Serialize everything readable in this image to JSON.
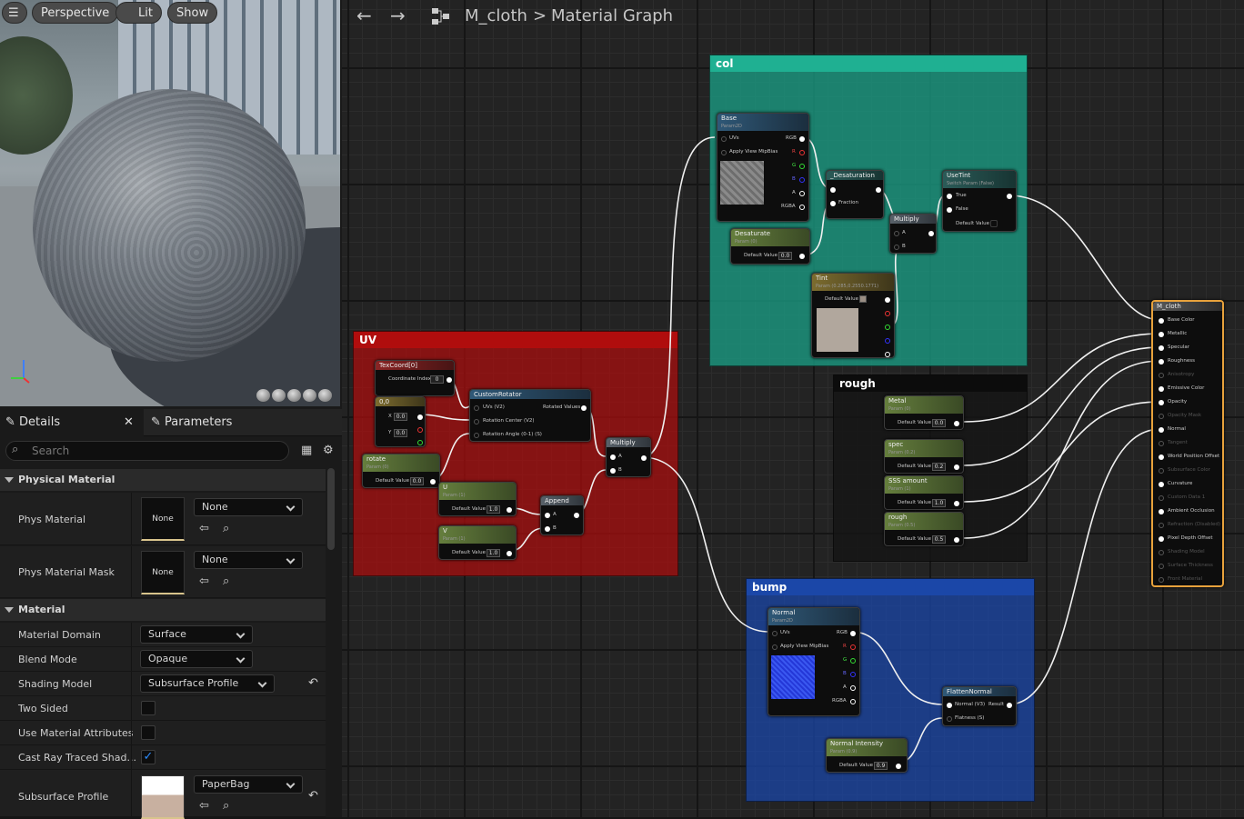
{
  "viewport": {
    "view_mode": "Perspective",
    "lit_mode": "Lit",
    "show_label": "Show"
  },
  "panel": {
    "details_tab": "Details",
    "parameters_tab": "Parameters",
    "search_placeholder": "Search",
    "physical_section": "Physical Material",
    "phys_material": {
      "label": "Phys Material",
      "thumb": "None",
      "value": "None"
    },
    "phys_material_mask": {
      "label": "Phys Material Mask",
      "thumb": "None",
      "value": "None"
    },
    "material_section": "Material",
    "material_domain": {
      "label": "Material Domain",
      "value": "Surface"
    },
    "blend_mode": {
      "label": "Blend Mode",
      "value": "Opaque"
    },
    "shading_model": {
      "label": "Shading Model",
      "value": "Subsurface Profile"
    },
    "two_sided": {
      "label": "Two Sided",
      "checked": false
    },
    "use_material_attributes": {
      "label": "Use Material Attributes",
      "checked": false
    },
    "cast_ray_traced": {
      "label": "Cast Ray Traced Shad...",
      "checked": true
    },
    "subsurface_profile": {
      "label": "Subsurface Profile",
      "value": "PaperBag"
    }
  },
  "graph": {
    "breadcrumb_asset": "M_cloth",
    "breadcrumb_sep": ">",
    "breadcrumb_page": "Material Graph",
    "comments": {
      "col": "col",
      "uv": "UV",
      "rough": "rough",
      "bump": "bump"
    },
    "nodes": {
      "base": {
        "title": "Base",
        "sub": "Param2D",
        "uvs": "UVs",
        "mip": "Apply View MipBias",
        "rgb": "RGB",
        "r": "R",
        "g": "G",
        "b": "B",
        "a": "A",
        "rgba": "RGBA"
      },
      "desat_fn": {
        "title": "_Desaturation",
        "frac": "Fraction"
      },
      "desaturate": {
        "title": "Desaturate",
        "sub": "Param (0)",
        "dv": "Default Value",
        "value": "0.0"
      },
      "multiply_col": {
        "title": "Multiply",
        "a": "A",
        "b": "B"
      },
      "usetint": {
        "title": "UseTint",
        "sub": "Switch Param (False)",
        "t": "True",
        "f": "False",
        "dv": "Default Value"
      },
      "tint": {
        "title": "Tint",
        "sub": "Param (0.285,0.2550.1771)",
        "dv": "Default Value"
      },
      "texcoord": {
        "title": "TexCoord[0]",
        "ci": "Coordinate Index",
        "value": "0"
      },
      "zero": {
        "title": "0,0",
        "x": "X",
        "xv": "0.0",
        "y": "Y",
        "yv": "0.0"
      },
      "rotate": {
        "title": "rotate",
        "sub": "Param (0)",
        "dv": "Default Value",
        "value": "0.0"
      },
      "custom_rotator": {
        "title": "CustomRotator",
        "uvs": "UVs (V2)",
        "rc": "Rotation Center (V2)",
        "ra": "Rotation Angle (0-1) (S)",
        "rv": "Rotated Values"
      },
      "u": {
        "title": "U",
        "sub": "Param (1)",
        "dv": "Default Value",
        "value": "1.0"
      },
      "v": {
        "title": "V",
        "sub": "Param (1)",
        "dv": "Default Value",
        "value": "1.0"
      },
      "append": {
        "title": "Append",
        "a": "A",
        "b": "B"
      },
      "multiply_uv": {
        "title": "Multiply",
        "a": "A",
        "b": "B"
      },
      "metal": {
        "title": "Metal",
        "sub": "Param (0)",
        "dv": "Default Value",
        "value": "0.0"
      },
      "spec": {
        "title": "spec",
        "sub": "Param (0.2)",
        "dv": "Default Value",
        "value": "0.2"
      },
      "sss": {
        "title": "SSS amount",
        "sub": "Param (1)",
        "dv": "Default Value",
        "value": "1.0"
      },
      "rough": {
        "title": "rough",
        "sub": "Param (0.5)",
        "dv": "Default Value",
        "value": "0.5"
      },
      "normal": {
        "title": "Normal",
        "sub": "Param2D",
        "uvs": "UVs",
        "mip": "Apply View MipBias",
        "rgb": "RGB",
        "r": "R",
        "g": "G",
        "b": "B",
        "a": "A",
        "rgba": "RGBA"
      },
      "flatten": {
        "title": "FlattenNormal",
        "n": "Normal (V3)",
        "res": "Result",
        "fl": "Flatness (S)"
      },
      "nint": {
        "title": "Normal Intensity",
        "sub": "Param (0.9)",
        "dv": "Default Value",
        "value": "0.9"
      },
      "mcloth": {
        "title": "M_cloth",
        "pins": [
          "Base Color",
          "Metallic",
          "Specular",
          "Roughness",
          "Anisotropy",
          "Emissive Color",
          "Opacity",
          "Opacity Mask",
          "Normal",
          "Tangent",
          "World Position Offset",
          "Subsurface Color",
          "Curvature",
          "Custom Data 1",
          "Ambient Occlusion",
          "Refraction (Disabled)",
          "Pixel Depth Offset",
          "Shading Model",
          "Surface Thickness",
          "Front Material"
        ]
      }
    }
  },
  "colors": {
    "col": "#1b9c84",
    "uv": "#b00d0d",
    "rough": "#1a1a1a",
    "bump": "#1b47a8",
    "accent": "#e8a23c"
  }
}
